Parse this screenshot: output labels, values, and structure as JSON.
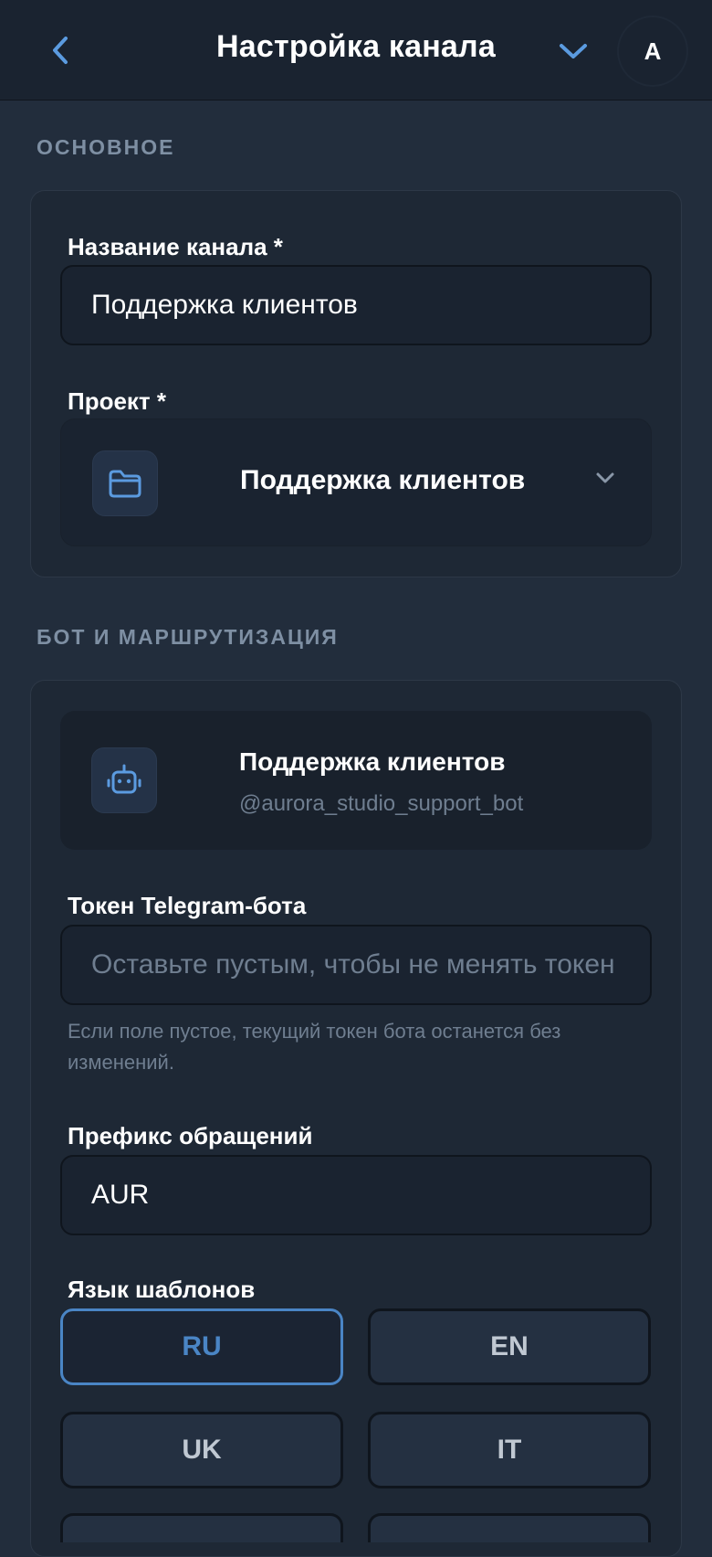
{
  "header": {
    "title": "Настройка канала",
    "avatar_initial": "A"
  },
  "sections": {
    "basic": "ОСНОВНОЕ",
    "bot": "БОТ И МАРШРУТИЗАЦИЯ"
  },
  "basic": {
    "channel_name_label": "Название канала *",
    "channel_name_value": "Поддержка клиентов",
    "project_label": "Проект *",
    "project_value": "Поддержка клиентов"
  },
  "bot": {
    "name": "Поддержка клиентов",
    "handle": "@aurora_studio_support_bot",
    "token_label": "Токен Telegram-бота",
    "token_placeholder": "Оставьте пустым, чтобы не менять токен",
    "token_hint": "Если поле пустое, текущий токен бота останется без изменений.",
    "prefix_label": "Префикс обращений",
    "prefix_value": "AUR",
    "language_label": "Язык шаблонов",
    "languages": [
      "RU",
      "EN",
      "UK",
      "IT"
    ],
    "selected_language": "RU"
  },
  "colors": {
    "accent": "#4a85c5",
    "background": "#222d3c",
    "header": "#1a2330"
  },
  "icons": {
    "back": "chevron-left-icon",
    "expand": "chevron-down-icon",
    "project": "folder-icon",
    "bot": "robot-icon"
  }
}
